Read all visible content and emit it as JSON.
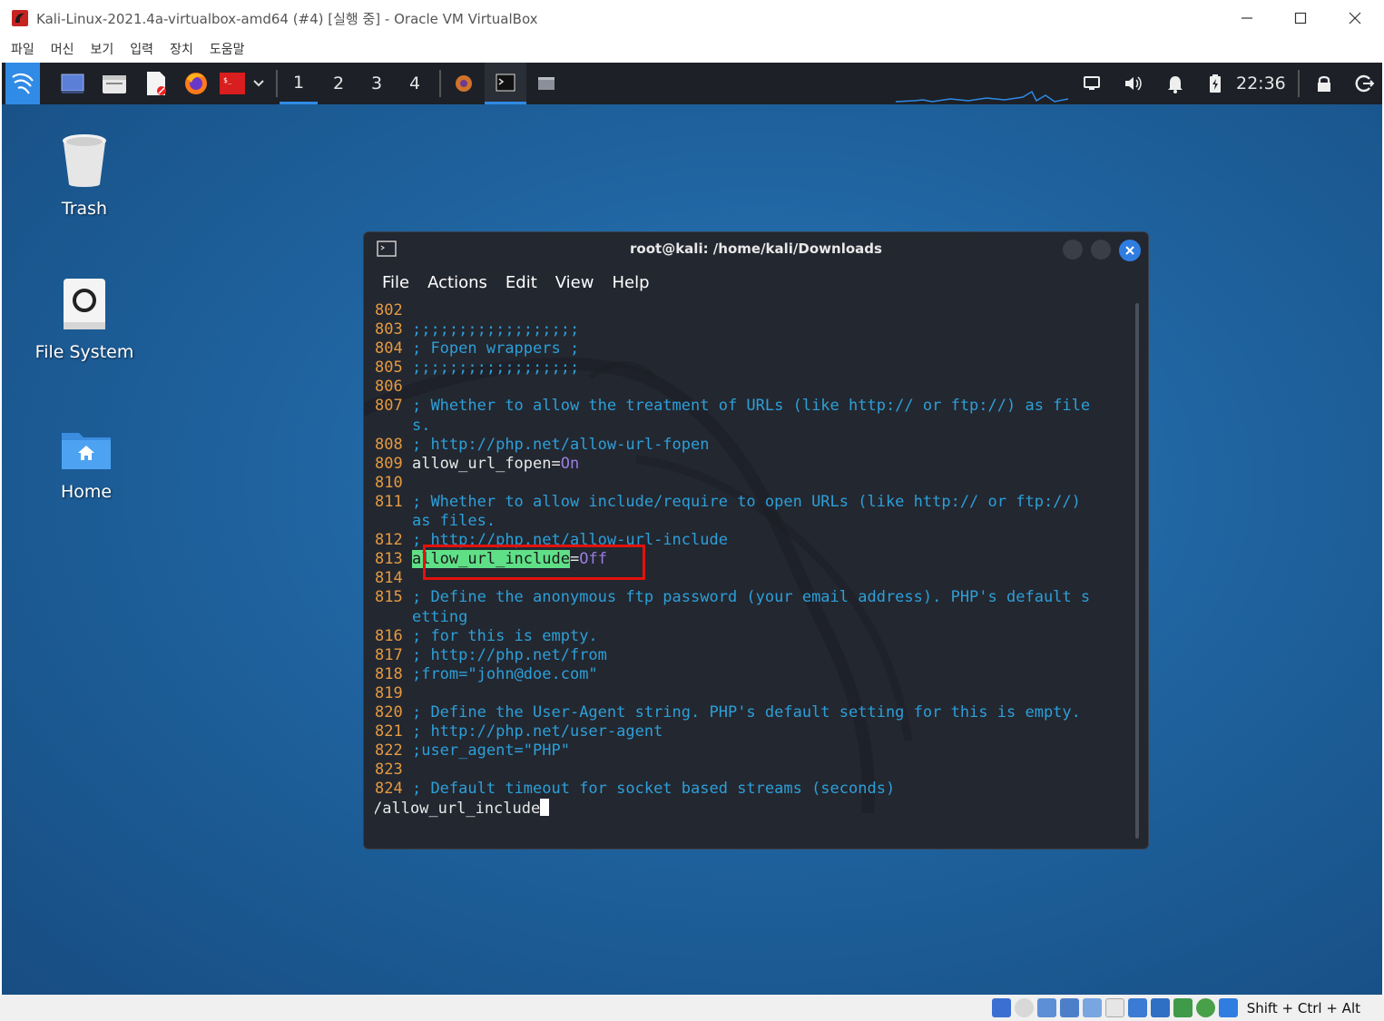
{
  "vbox": {
    "title": "Kali-Linux-2021.4a-virtualbox-amd64 (#4) [실행 중] - Oracle VM VirtualBox",
    "menu": [
      "파일",
      "머신",
      "보기",
      "입력",
      "장치",
      "도움말"
    ],
    "status_host_key": "Shift + Ctrl + Alt"
  },
  "panel": {
    "workspaces": [
      "1",
      "2",
      "3",
      "4"
    ],
    "active_workspace": "1",
    "clock": "22:36"
  },
  "desktop": {
    "icons": [
      {
        "label": "Trash"
      },
      {
        "label": "File System"
      },
      {
        "label": "Home"
      }
    ]
  },
  "terminal": {
    "title": "root@kali: /home/kali/Downloads",
    "menu": [
      "File",
      "Actions",
      "Edit",
      "View",
      "Help"
    ],
    "lines": [
      {
        "n": "802",
        "t": ""
      },
      {
        "n": "803",
        "t": ";;;;;;;;;;;;;;;;;;"
      },
      {
        "n": "804",
        "t": "; Fopen wrappers ;"
      },
      {
        "n": "805",
        "t": ";;;;;;;;;;;;;;;;;;"
      },
      {
        "n": "806",
        "t": ""
      },
      {
        "n": "807",
        "t": "; Whether to allow the treatment of URLs (like http:// or ftp://) as file"
      },
      {
        "n": "",
        "t": "s."
      },
      {
        "n": "808",
        "t": "; http://php.net/allow-url-fopen"
      },
      {
        "n": "809",
        "key": "allow_url_fopen",
        "eq": "=",
        "val": "On"
      },
      {
        "n": "810",
        "t": ""
      },
      {
        "n": "811",
        "t": "; Whether to allow include/require to open URLs (like http:// or ftp://)"
      },
      {
        "n": "",
        "t": "as files."
      },
      {
        "n": "812",
        "t": "; http://php.net/allow-url-include"
      },
      {
        "n": "813",
        "key": "allow_url_include",
        "eq": "=",
        "val": "Off"
      },
      {
        "n": "814",
        "t": ""
      },
      {
        "n": "815",
        "t": "; Define the anonymous ftp password (your email address). PHP's default s"
      },
      {
        "n": "",
        "t": "etting"
      },
      {
        "n": "816",
        "t": "; for this is empty."
      },
      {
        "n": "817",
        "t": "; http://php.net/from"
      },
      {
        "n": "818",
        "t": ";from=\"john@doe.com\""
      },
      {
        "n": "819",
        "t": ""
      },
      {
        "n": "820",
        "t": "; Define the User-Agent string. PHP's default setting for this is empty."
      },
      {
        "n": "821",
        "t": "; http://php.net/user-agent"
      },
      {
        "n": "822",
        "t": ";user_agent=\"PHP\""
      },
      {
        "n": "823",
        "t": ""
      },
      {
        "n": "824",
        "t": "; Default timeout for socket based streams (seconds)"
      }
    ],
    "search_prompt": "/allow_url_include"
  }
}
